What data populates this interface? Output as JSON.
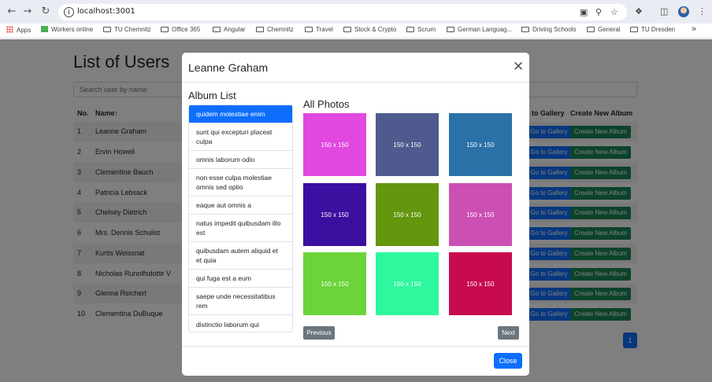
{
  "browser": {
    "url": "localhost:3001",
    "bookmarks": [
      "Apps",
      "Workers online",
      "TU Chemnitz",
      "Office 365",
      "Angular",
      "Chemnitz",
      "Travel",
      "Stock & Crypto",
      "Scrum",
      "German Languag...",
      "Driving Schools",
      "General",
      "TU Dresden"
    ],
    "more_bookmarks": "»"
  },
  "page": {
    "title": "List of Users",
    "search_placeholder": "Search user by name",
    "columns": [
      "No.",
      "Name",
      "Go to Gallery",
      "Create New Album"
    ],
    "sort_indicator": "↑",
    "rows": [
      {
        "no": "1",
        "name": "Leanne Graham"
      },
      {
        "no": "2",
        "name": "Ervin Howell"
      },
      {
        "no": "3",
        "name": "Clementine Bauch"
      },
      {
        "no": "4",
        "name": "Patricia Lebsack"
      },
      {
        "no": "5",
        "name": "Chelsey Dietrich"
      },
      {
        "no": "6",
        "name": "Mrs. Dennis Schulist"
      },
      {
        "no": "7",
        "name": "Kurtis Weissnat"
      },
      {
        "no": "8",
        "name": "Nicholas Runolfsdottir V"
      },
      {
        "no": "9",
        "name": "Glenna Reichert"
      },
      {
        "no": "10",
        "name": "Clementina DuBuque"
      }
    ],
    "gallery_button": "Go to Gallery",
    "album_button": "Create New Album",
    "current_page": "1"
  },
  "modal": {
    "title": "Leanne Graham",
    "album_heading": "Album List",
    "albums": [
      "quidem molestiae enim",
      "sunt qui excepturi placeat culpa",
      "omnis laborum odio",
      "non esse culpa molestiae omnis sed optio",
      "eaque aut omnis a",
      "natus impedit quibusdam illo est",
      "quibusdam autem aliquid et et quia",
      "qui fuga est a eum",
      "saepe unde necessitatibus rem",
      "distinctio laborum qui"
    ],
    "active_album_index": 0,
    "photos_heading": "All Photos",
    "photos": [
      {
        "label": "150 x 150",
        "color": "#e048e0"
      },
      {
        "label": "150 x 150",
        "color": "#4f5a8e"
      },
      {
        "label": "150 x 150",
        "color": "#2a71a8"
      },
      {
        "label": "150 x 150",
        "color": "#3b0fa0"
      },
      {
        "label": "150 x 150",
        "color": "#64960e"
      },
      {
        "label": "150 x 150",
        "color": "#cc4fb4"
      },
      {
        "label": "150 x 150",
        "color": "#6ad43a"
      },
      {
        "label": "150 x 150",
        "color": "#2ef79e"
      },
      {
        "label": "150 x 150",
        "color": "#c70b4e"
      }
    ],
    "prev_label": "Previous",
    "next_label": "Next",
    "close_label": "Close"
  },
  "colors": {
    "primary": "#0d6efd",
    "success": "#198754",
    "secondary": "#6c757d"
  }
}
